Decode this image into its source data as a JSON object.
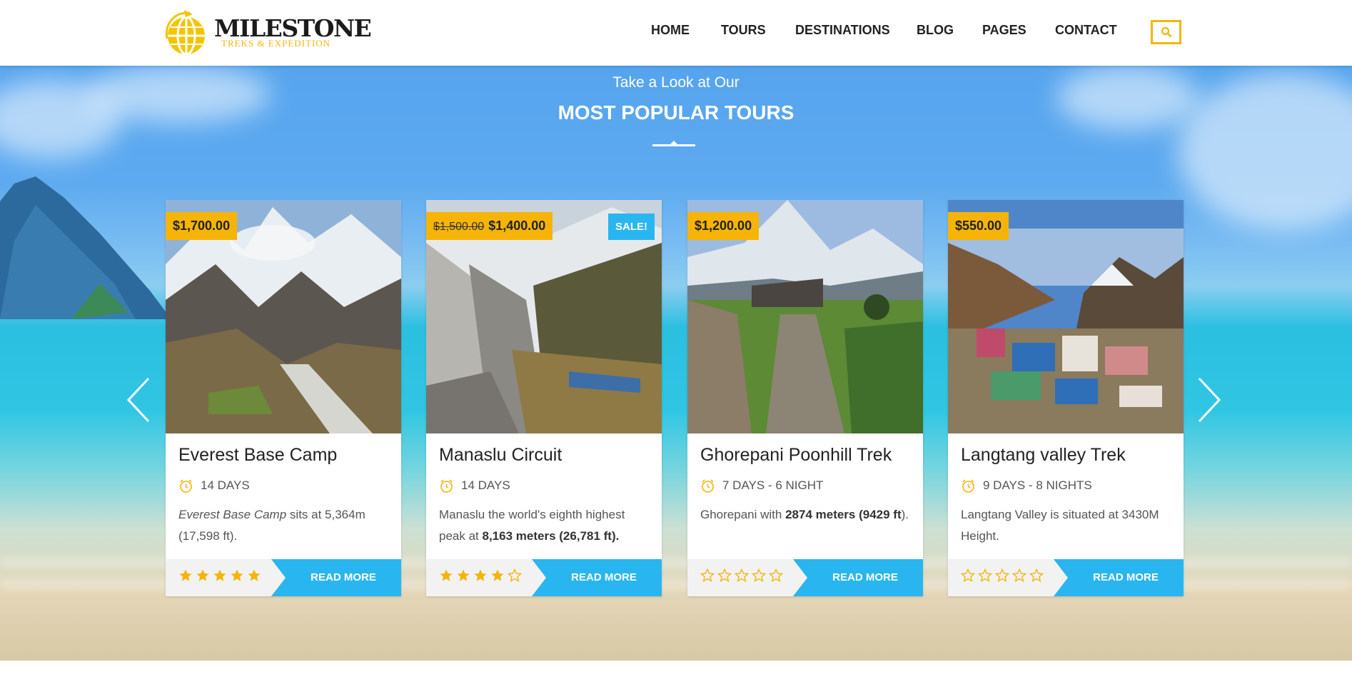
{
  "header": {
    "logo": {
      "name": "MILESTONE",
      "tagline": "TREKS & EXPEDITION"
    },
    "nav": [
      {
        "label": "HOME"
      },
      {
        "label": "TOURS"
      },
      {
        "label": "DESTINATIONS"
      },
      {
        "label": "BLOG"
      },
      {
        "label": "PAGES"
      },
      {
        "label": "CONTACT"
      }
    ],
    "search_icon": "search-icon"
  },
  "section": {
    "subtitle": "Take a Look at Our",
    "title": "MOST POPULAR TOURS"
  },
  "carousel": {
    "prev_icon": "chevron-left-icon",
    "next_icon": "chevron-right-icon"
  },
  "tours": [
    {
      "title": "Everest Base Camp",
      "price": "$1,700.00",
      "old_price": "",
      "badge": "",
      "duration": "14 DAYS",
      "desc_parts": [
        {
          "text": "Everest Base Camp",
          "style": "italic"
        },
        {
          "text": " sits at 5,364m (17,598 ft).",
          "style": "normal"
        }
      ],
      "rating": 5,
      "read_more": "READ MORE"
    },
    {
      "title": "Manaslu Circuit",
      "price": "$1,400.00",
      "old_price": "$1,500.00",
      "badge": "SALE!",
      "duration": "14 DAYS",
      "desc_parts": [
        {
          "text": "Manaslu the world's eighth highest peak at ",
          "style": "normal"
        },
        {
          "text": "8,163 meters (26,781 ft).",
          "style": "bold"
        }
      ],
      "rating": 4,
      "read_more": "READ MORE"
    },
    {
      "title": "Ghorepani Poonhill Trek",
      "price": "$1,200.00",
      "old_price": "",
      "badge": "",
      "duration": "7 DAYS - 6 NIGHT",
      "desc_parts": [
        {
          "text": "Ghorepani with ",
          "style": "normal"
        },
        {
          "text": "2874 meters (9429 ft",
          "style": "bold"
        },
        {
          "text": ").",
          "style": "normal"
        }
      ],
      "rating": 0,
      "read_more": "READ MORE"
    },
    {
      "title": "Langtang valley Trek",
      "price": "$550.00",
      "old_price": "",
      "badge": "",
      "duration": "9 DAYS - 8 NIGHTS",
      "desc_parts": [
        {
          "text": "Langtang Valley is situated at 3430M Height.",
          "style": "normal"
        }
      ],
      "rating": 0,
      "read_more": "READ MORE"
    }
  ],
  "colors": {
    "accent": "#f5b407",
    "button": "#29b6f0",
    "star": "#f5b407"
  }
}
